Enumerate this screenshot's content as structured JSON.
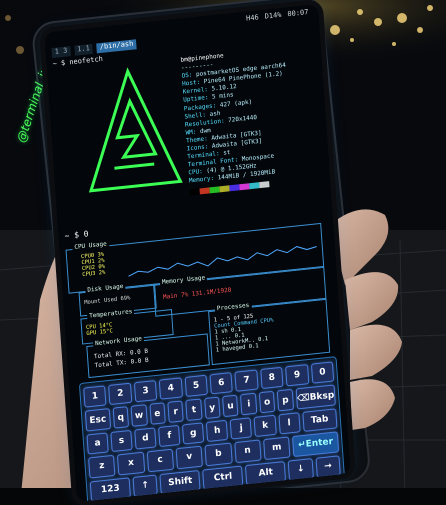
{
  "status_bar": {
    "network": "H46",
    "battery": "D14%",
    "time": "00:07"
  },
  "tabs": [
    "1 3",
    "1.1",
    "/bin/ash"
  ],
  "terminal": {
    "prompt": "~ $ neofetch",
    "user_host": "bm@pinephone",
    "info": [
      {
        "key": "OS:",
        "value": "postmarketOS edge aarch64"
      },
      {
        "key": "Host:",
        "value": "Pine64 PinePhone (1.2)"
      },
      {
        "key": "Kernel:",
        "value": "5.10.12"
      },
      {
        "key": "Uptime:",
        "value": "5 mins"
      },
      {
        "key": "Packages:",
        "value": "427 (apk)"
      },
      {
        "key": "Shell:",
        "value": "ash"
      },
      {
        "key": "Resolution:",
        "value": "720x1440"
      },
      {
        "key": "WM:",
        "value": "dwm"
      },
      {
        "key": "Theme:",
        "value": "Adwaita [GTK3]"
      },
      {
        "key": "Icons:",
        "value": "Adwaita [GTK3]"
      },
      {
        "key": "Terminal:",
        "value": "st"
      },
      {
        "key": "Terminal Font:",
        "value": "Monospace"
      },
      {
        "key": "CPU:",
        "value": "(4) @ 1.152GHz"
      },
      {
        "key": "Memory:",
        "value": "144MiB / 1920MiB"
      }
    ],
    "palette": [
      "#000000",
      "#c23621",
      "#25bc24",
      "#adad27",
      "#492ee1",
      "#d338d3",
      "#33bbc8",
      "#cbcccd"
    ],
    "prompt2": "~ $ 0"
  },
  "btop": {
    "cpu_title": "CPU Usage",
    "cpu_rows": [
      "CPU0  3%",
      "CPU1  2%",
      "CPU2  0%",
      "CPU3  2%"
    ],
    "memory_title": "Memory Usage",
    "memory_row": "Main  7% 131.1M/1920",
    "disk_title": "Disk Usage",
    "disk_row": "Mount  Used  69%",
    "temp_title": "Temperatures",
    "temp_rows": [
      "CPU  14°C",
      "GPU  15°C"
    ],
    "processes_title": "Processes",
    "processes_header": "Count  Command  CPU%",
    "processes_rows": [
      "1   sh   0.1",
      "1   ...  0.1",
      "1   NetworkM.. 0.1",
      "1   haveged  0.1"
    ],
    "processes_page": "1 - 5 of 125",
    "network_title": "Network Usage",
    "network_rx": "Total RX:  0.0 B",
    "network_tx": "Total TX:  0.0 B"
  },
  "keyboard": {
    "row1": [
      "1",
      "2",
      "3",
      "4",
      "5",
      "6",
      "7",
      "8",
      "9",
      "0"
    ],
    "row2": [
      "Esc",
      "q",
      "w",
      "e",
      "r",
      "t",
      "y",
      "u",
      "i",
      "o",
      "p",
      "⌫Bksp"
    ],
    "row3": [
      "a",
      "s",
      "d",
      "f",
      "g",
      "h",
      "j",
      "k",
      "l",
      "Tab"
    ],
    "row4": [
      "z",
      "x",
      "c",
      "v",
      "b",
      "n",
      "m",
      "↵Enter"
    ],
    "row5": [
      "123",
      "↑",
      "Shift",
      "Ctrl",
      "Alt",
      "↓",
      "→"
    ]
  },
  "watermark": "@terminal_junkie"
}
